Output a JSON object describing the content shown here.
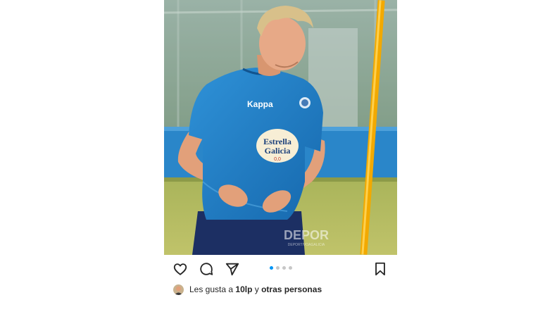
{
  "post": {
    "image": {
      "shirt_sponsor_line1": "Estrella",
      "shirt_sponsor_line2": "Galicia",
      "shirt_sponsor_line3": "0,0",
      "shirt_brand": "Kappa",
      "watermark": "DEPOR",
      "watermark_sub": "DEPORTIVOAGALICIA"
    },
    "actions": {
      "like_icon": "heart-icon",
      "comment_icon": "comment-icon",
      "share_icon": "send-icon",
      "save_icon": "bookmark-icon"
    },
    "carousel": {
      "count": 4,
      "active": 1
    },
    "likes": {
      "prefix": "Les gusta a ",
      "user": "10lp",
      "middle": " y ",
      "others": "otras personas"
    }
  },
  "colors": {
    "accent": "#0095f6",
    "text": "#262626",
    "shirt": "#1f7fc7",
    "pole": "#f2a900"
  }
}
